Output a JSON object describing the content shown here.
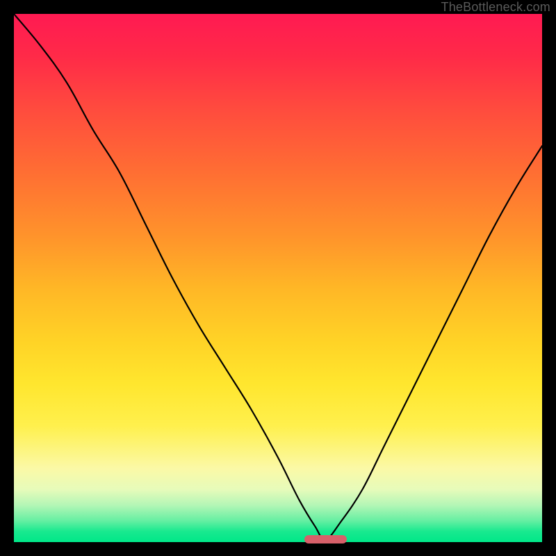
{
  "watermark": "TheBottleneck.com",
  "colors": {
    "background": "#000000",
    "curve": "#000000",
    "marker": "#d8606a"
  },
  "chart_data": {
    "type": "line",
    "title": "",
    "xlabel": "",
    "ylabel": "",
    "xlim": [
      0,
      100
    ],
    "ylim": [
      0,
      100
    ],
    "grid": false,
    "series": [
      {
        "name": "left-branch",
        "x": [
          0,
          5,
          10,
          15,
          20,
          25,
          30,
          35,
          40,
          45,
          50,
          54,
          57,
          59
        ],
        "values": [
          100,
          94,
          87,
          78,
          70,
          60,
          50,
          41,
          33,
          25,
          16,
          8,
          3,
          0.5
        ]
      },
      {
        "name": "right-branch",
        "x": [
          59,
          62,
          66,
          70,
          75,
          80,
          85,
          90,
          95,
          100
        ],
        "values": [
          0.5,
          4,
          10,
          18,
          28,
          38,
          48,
          58,
          67,
          75
        ]
      }
    ],
    "annotations": [
      {
        "name": "optimal-marker",
        "x_start": 55,
        "x_end": 63,
        "y": 0.5
      }
    ]
  }
}
